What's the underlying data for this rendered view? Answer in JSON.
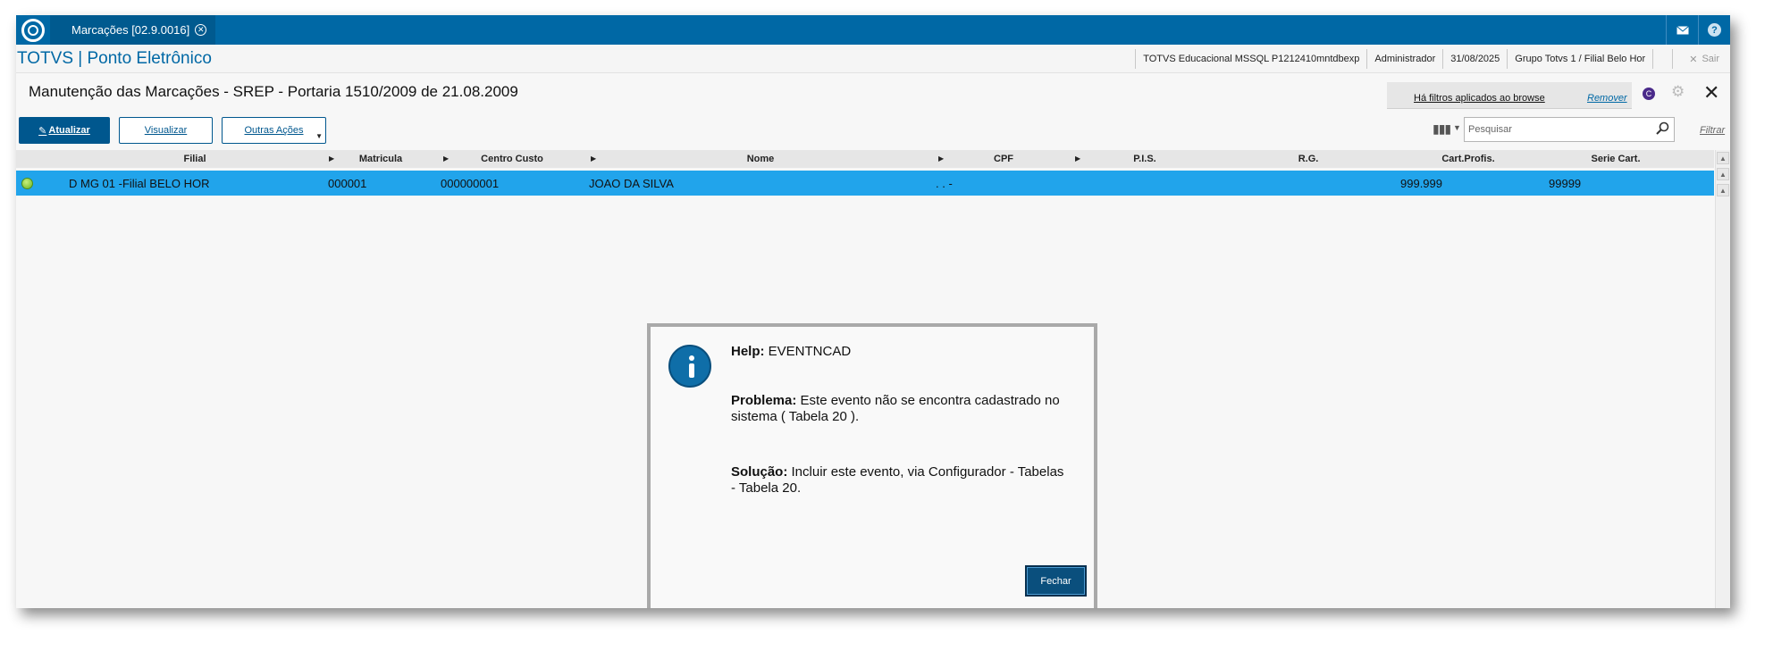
{
  "tabbar": {
    "tab_label": "Marcações [02.9.0016]",
    "tab_close_glyph": "✕",
    "mail_icon": "mail-icon",
    "help_icon_glyph": "?"
  },
  "header": {
    "product_title": "TOTVS | Ponto Eletrônico",
    "environment": "TOTVS Educacional MSSQL P121241​0mntdbexp",
    "user": "Administrador",
    "date": "31/08/2025",
    "company": "Grupo Totvs 1 / Filial Belo Hor",
    "exit_label": "Sair"
  },
  "routine": {
    "title": "Manutenção das Marcações - SREP - Portaria 1510/2009 de 21.08.2009",
    "filter_notice": "Há filtros aplicados ao browse",
    "filter_remove": "Remover",
    "c_badge": "C"
  },
  "toolbar": {
    "atualizar_label": "Atualizar",
    "visualizar_label": "Visualizar",
    "outras_label": "Outras Ações",
    "search_placeholder": "Pesquisar",
    "filtrar_label": "Filtrar"
  },
  "grid": {
    "columns": [
      "Filial",
      "Matricula",
      "Centro Custo",
      "Nome",
      "CPF",
      "P.I.S.",
      "R.G.",
      "Cart.Profis.",
      "Serie Cart."
    ],
    "row": {
      "filial": "D MG 01 -Filial BELO HOR",
      "matricula": "000001",
      "centro_custo": "000000001",
      "nome": "JOAO DA SILVA",
      "cpf": ". . -",
      "pis": "",
      "rg": "",
      "cart_profis": "999.999",
      "serie_cart": "99999"
    }
  },
  "modal": {
    "help_label": "Help:",
    "help_value": "EVENTNCAD",
    "problem_label": "Problema:",
    "problem_text": "Este evento não se encontra cadastrado no sistema ( Tabela 20 ).",
    "solution_label": "Solução:",
    "solution_text": "Incluir este evento, via Configurador - Tabelas - Tabela 20.",
    "close_button": "Fechar"
  },
  "colors": {
    "brand_blue": "#0068a5",
    "selected_row": "#21a4eb",
    "button_dark": "#00578e"
  }
}
